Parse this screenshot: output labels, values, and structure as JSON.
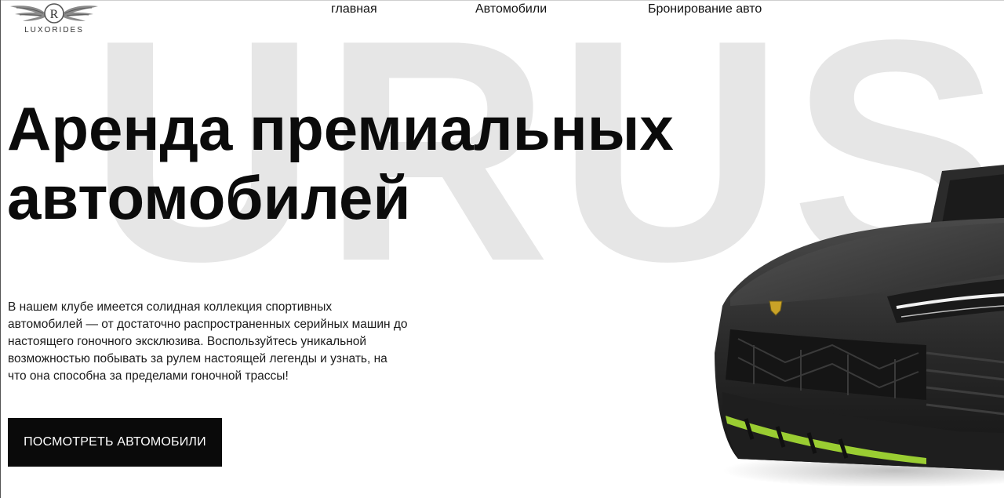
{
  "brand": {
    "logo_text": "LUXORIDES",
    "monogram": "R"
  },
  "nav": {
    "items": [
      {
        "label": "главная"
      },
      {
        "label": "Автомобили"
      },
      {
        "label": "Бронирование авто"
      }
    ]
  },
  "hero": {
    "watermark": "URUS",
    "headline_line1": "Аренда премиальных",
    "headline_line2": "автомобилей",
    "description": "В нашем клубе имеется солидная коллекция спортивных автомобилей — от достаточно распространенных серийных машин до настоящего гоночного эксклюзива. Воспользуйтесь уникальной возможностью побывать за рулем настоящей легенды и узнать, на что она способна за пределами гоночной трассы!",
    "cta_label": "ПОСМОТРЕТЬ АВТОМОБИЛИ"
  },
  "colors": {
    "accent": "#9acd32",
    "cta_background": "#0a0a0a",
    "watermark": "#e6e6e6"
  }
}
